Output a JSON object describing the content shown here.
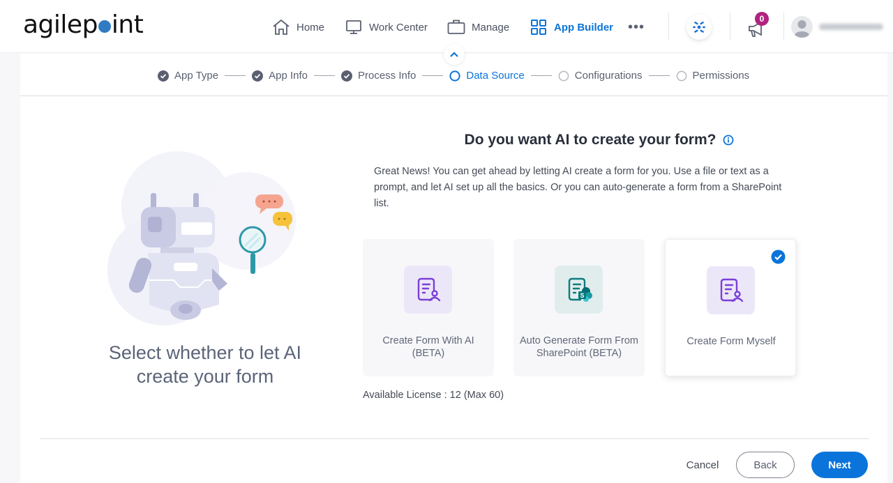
{
  "header": {
    "logo_text_before": "agilep",
    "logo_text_after": "int",
    "nav": [
      {
        "label": "Home",
        "icon": "home-icon"
      },
      {
        "label": "Work Center",
        "icon": "monitor-icon"
      },
      {
        "label": "Manage",
        "icon": "briefcase-icon"
      },
      {
        "label": "App Builder",
        "icon": "grid-icon",
        "active": true
      }
    ],
    "more_label": "•••",
    "notification_count": "0",
    "username": "(blurred)"
  },
  "stepper": {
    "steps": [
      {
        "label": "App Type",
        "state": "complete"
      },
      {
        "label": "App Info",
        "state": "complete"
      },
      {
        "label": "Process Info",
        "state": "complete"
      },
      {
        "label": "Data Source",
        "state": "current"
      },
      {
        "label": "Configurations",
        "state": "pending"
      },
      {
        "label": "Permissions",
        "state": "pending"
      }
    ]
  },
  "left": {
    "caption": "Select whether to let AI create your form"
  },
  "main": {
    "question": "Do you want AI to create your form?",
    "description": "Great News! You can get ahead by letting AI create a form for you. Use a file or text as a prompt, and let AI set up all the basics. Or you can auto-generate a form from a SharePoint list.",
    "options": [
      {
        "label": "Create Form With AI (BETA)",
        "selected": false
      },
      {
        "label": "Auto Generate Form From SharePoint (BETA)",
        "selected": false
      },
      {
        "label": "Create Form Myself",
        "selected": true
      }
    ],
    "license": "Available License : 12 (Max 60)"
  },
  "footer": {
    "cancel": "Cancel",
    "back": "Back",
    "next": "Next"
  },
  "colors": {
    "accent": "#0a74da",
    "badge": "#b0237f",
    "ai_icon": "#7a3fd8",
    "sharepoint_icon": "#0f7b7b"
  }
}
